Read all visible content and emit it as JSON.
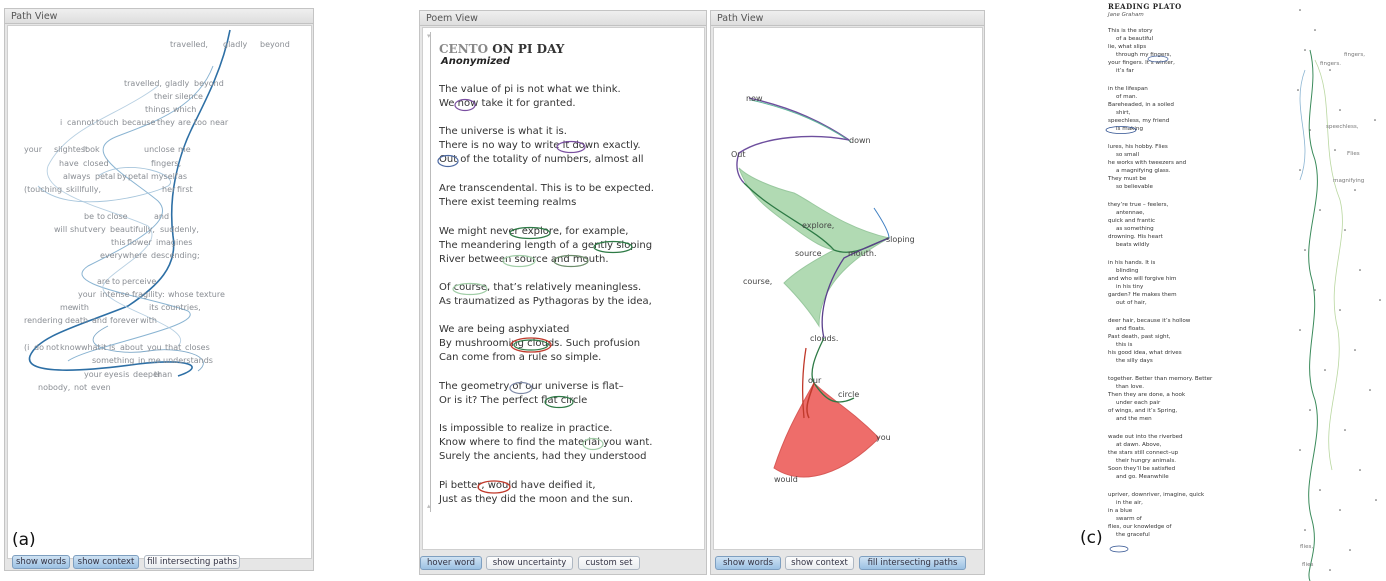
{
  "panel_a": {
    "title": "Path View",
    "tag": "(a)",
    "words": [
      "travelled,",
      "gladly",
      "beyond",
      "travelled,",
      "gladly",
      "beyond",
      "their",
      "silence",
      "things",
      "which",
      "i",
      "cannot",
      "touch",
      "because",
      "they",
      "are",
      "too",
      "near",
      "your",
      "slightest",
      "look",
      "unclose",
      "me",
      "have",
      "closed",
      "fingers,",
      "always",
      "petal",
      "by",
      "petal",
      "myself",
      "as",
      "(touching",
      "skillfully,",
      "her",
      "first",
      "be",
      "to",
      "close",
      "and",
      "will",
      "shut",
      "very",
      "beautifully,",
      "suddenly,",
      "this",
      "flower",
      "imagines",
      "everywhere",
      "descending;",
      "are",
      "to",
      "perceive",
      "your",
      "intense",
      "fragility:",
      "whose",
      "texture",
      "me",
      "with",
      "its",
      "countries,",
      "rendering",
      "death",
      "and",
      "forever",
      "with",
      "(i",
      "do",
      "not",
      "know",
      "what",
      "it",
      "is",
      "about",
      "you",
      "that",
      "closes",
      "something",
      "in",
      "me",
      "understands",
      "your",
      "eyes",
      "is",
      "deeper",
      "than",
      "nobody,",
      "not",
      "even"
    ],
    "buttons": {
      "words": "show words",
      "context": "show context",
      "fill": "fill intersecting paths"
    }
  },
  "panel_b": {
    "title": "Poem View",
    "poem_title_1": "CENTO",
    "poem_title_2": "ON PI DAY",
    "author": "Anonymized",
    "lines": [
      "The value of pi is not what we think.",
      "We now take it for granted.",
      "The universe is what it is.",
      "There is no way to write it down exactly.",
      "Out of the totality of numbers, almost all",
      "Are transcendental.  This is to be expected.",
      "There exist teeming realms",
      "We might never explore, for example,",
      "The meandering length of a gently sloping",
      "River between source and mouth.",
      "Of course, that’s relatively meaningless.",
      "As traumatized as Pythagoras by the idea,",
      "We are being asphyxiated",
      "By mushrooming clouds.  Such profusion",
      "Can come from a rule so simple.",
      "The geometry of our universe is flat–",
      "Or is it? The perfect flat circle",
      "Is impossible to realize in practice.",
      "Know where to find the material you want.",
      "Surely the ancients, had they understood",
      "Pi better, would have deified it,",
      "Just as they did the moon and the sun."
    ],
    "buttons": {
      "hover": "hover word",
      "uncertainty": "show uncertainty",
      "custom": "custom set"
    }
  },
  "panel_path2": {
    "title": "Path View",
    "labels": [
      "now",
      "down",
      "Out",
      "explore,",
      "sloping",
      "source",
      "mouth.",
      "course,",
      "clouds.",
      "our",
      "circle",
      "you",
      "would"
    ],
    "buttons": {
      "words": "show words",
      "context": "show context",
      "fill": "fill intersecting paths"
    }
  },
  "panel_c": {
    "tag": "(c)",
    "title": "READING  PLATO",
    "author": "Jane Graham",
    "lines": [
      "This is the story",
      "of a beautiful",
      "lie, what slips",
      "through my fingers,",
      "your fingers. It’s winter,",
      "it’s far",
      "in the lifespan",
      "of man.",
      "Bareheaded, in a soiled",
      "shirt,",
      "speechless, my friend",
      "is making",
      "lures, his hobby. Flies",
      "so small",
      "he works with tweezers and",
      "a magnifying glass.",
      "They must be",
      "so believable",
      "they’re true – feelers,",
      "antennae,",
      "quick and frantic",
      "as something",
      "drowning. His heart",
      "beats wildly",
      "in his hands. It is",
      "blinding",
      "and who will forgive him",
      "in his tiny",
      "garden? He makes them",
      "out of hair,",
      "deer hair, because it’s hollow",
      "and floats.",
      "Past death, past sight,",
      "this is",
      "his good idea, what drives",
      "the silly days",
      "together. Better than memory. Better",
      "than love.",
      "Then they are done, a hook",
      "under each pair",
      "of wings, and it’s Spring,",
      "and the men",
      "wade out into the riverbed",
      "at dawn. Above,",
      "the stars still connect–up",
      "their hungry animals.",
      "Soon they’ll be satisfied",
      "and go. Meanwhile",
      "upriver, downriver, imagine, quick",
      "in the air,",
      "in a blue",
      "swarm of",
      "flies, our knowledge of",
      "the graceful"
    ],
    "side_labels": [
      "fingers,",
      "fingers.",
      "speechless,",
      "Flies",
      "magnifying",
      "flies,",
      "flies"
    ]
  }
}
